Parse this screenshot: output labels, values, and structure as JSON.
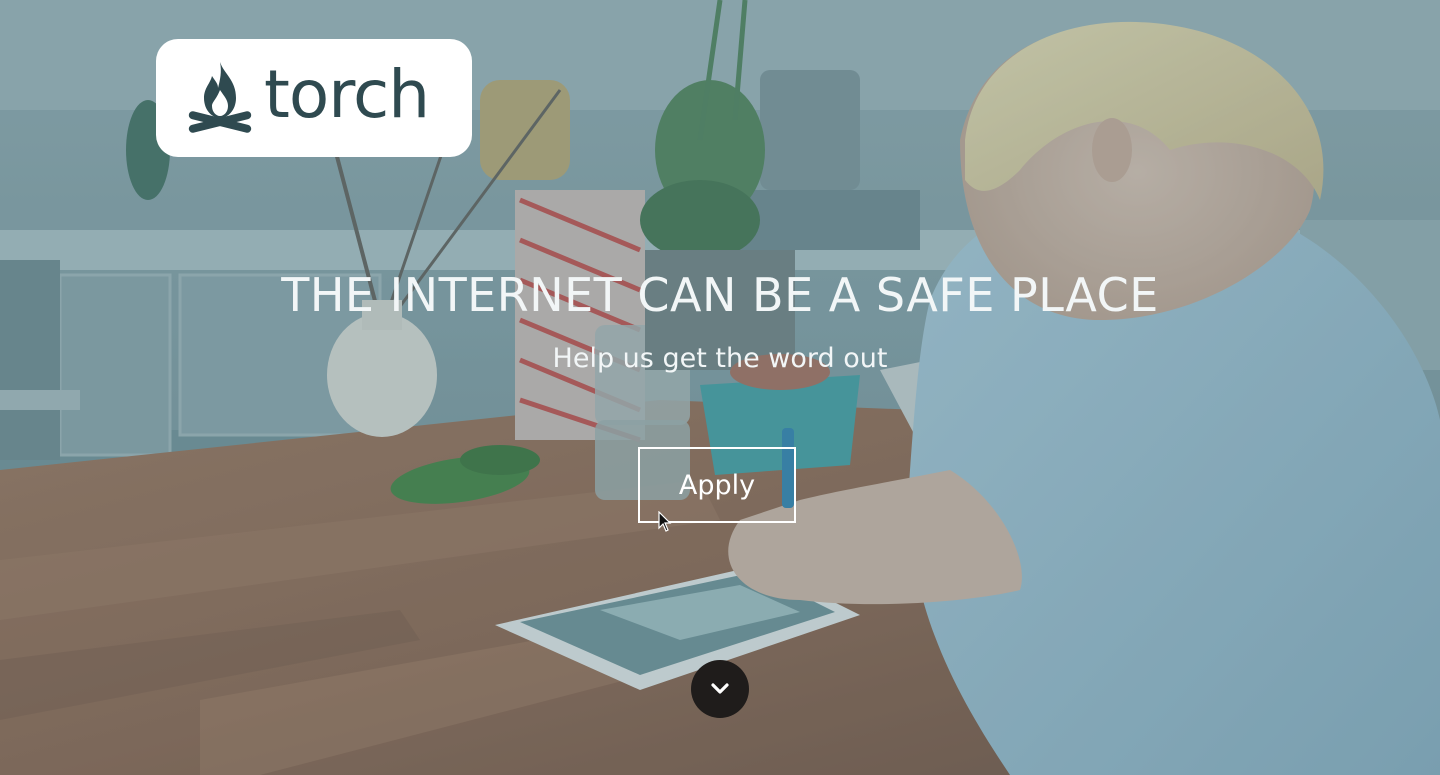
{
  "brand": {
    "name": "torch",
    "text_color": "#2f4a50",
    "icon": "campfire-icon"
  },
  "hero": {
    "headline": "THE INTERNET CAN BE A SAFE PLACE",
    "subheadline": "Help us get the word out",
    "apply_label": "Apply",
    "scroll_icon": "chevron-down-icon",
    "overlay_color": "#5a828c"
  }
}
